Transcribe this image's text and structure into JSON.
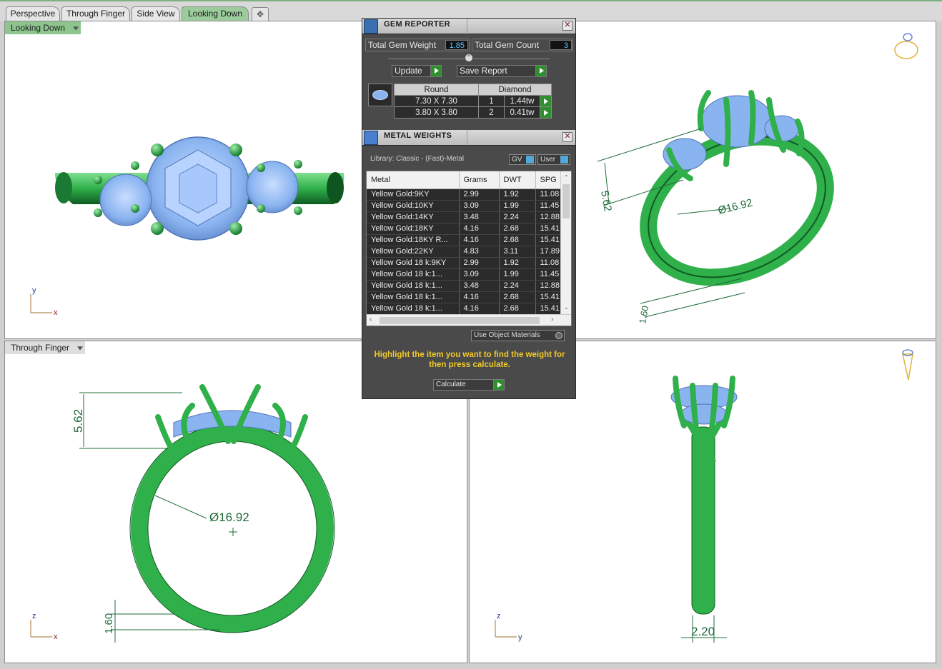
{
  "tabs": [
    {
      "label": "Perspective",
      "active": false
    },
    {
      "label": "Through Finger",
      "active": false
    },
    {
      "label": "Side View",
      "active": false
    },
    {
      "label": "Looking Down",
      "active": true
    }
  ],
  "viewports": {
    "top_left": {
      "title": "Looking Down",
      "axis_a": "y",
      "axis_b": "x"
    },
    "top_right": {
      "dim_height": "5.62",
      "dim_diameter": "Ø16.92",
      "dim_band": "1.60"
    },
    "bottom_left": {
      "title": "Through Finger",
      "axis_a": "z",
      "axis_b": "x",
      "dim_height": "5.62",
      "dim_diameter": "Ø16.92",
      "dim_band": "1.60"
    },
    "bottom_right": {
      "axis_a": "z",
      "axis_b": "y",
      "dim_width": "2.20"
    }
  },
  "gem_reporter": {
    "title": "GEM REPORTER",
    "total_weight_label": "Total Gem Weight",
    "total_weight_value": "1.85",
    "total_count_label": "Total Gem Count",
    "total_count_value": "3",
    "update_label": "Update",
    "save_report_label": "Save Report",
    "table_headers": [
      "Round",
      "Diamond"
    ],
    "rows": [
      {
        "size": "7.30 X 7.30",
        "count": "1",
        "weight": "1.44tw"
      },
      {
        "size": "3.80 X 3.80",
        "count": "2",
        "weight": "0.41tw"
      }
    ]
  },
  "metal_weights": {
    "title": "METAL WEIGHTS",
    "library_label": "Library: Classic - (Fast)-Metal",
    "gv_label": "GV",
    "user_label": "User",
    "headers": [
      "Metal",
      "Grams",
      "DWT",
      "SPG"
    ],
    "rows": [
      {
        "metal": "Yellow Gold:9KY",
        "grams": "2.99",
        "dwt": "1.92",
        "spg": "11.08"
      },
      {
        "metal": "Yellow Gold:10KY",
        "grams": "3.09",
        "dwt": "1.99",
        "spg": "11.45"
      },
      {
        "metal": "Yellow Gold:14KY",
        "grams": "3.48",
        "dwt": "2.24",
        "spg": "12.88"
      },
      {
        "metal": "Yellow Gold:18KY",
        "grams": "4.16",
        "dwt": "2.68",
        "spg": "15.41"
      },
      {
        "metal": "Yellow Gold:18KY R...",
        "grams": "4.16",
        "dwt": "2.68",
        "spg": "15.41"
      },
      {
        "metal": "Yellow Gold:22KY",
        "grams": "4.83",
        "dwt": "3.11",
        "spg": "17.89"
      },
      {
        "metal": "Yellow Gold 18 k:9KY",
        "grams": "2.99",
        "dwt": "1.92",
        "spg": "11.08"
      },
      {
        "metal": "Yellow Gold 18 k:1...",
        "grams": "3.09",
        "dwt": "1.99",
        "spg": "11.45"
      },
      {
        "metal": "Yellow Gold 18 k:1...",
        "grams": "3.48",
        "dwt": "2.24",
        "spg": "12.88"
      },
      {
        "metal": "Yellow Gold 18 k:1...",
        "grams": "4.16",
        "dwt": "2.68",
        "spg": "15.41"
      },
      {
        "metal": "Yellow Gold 18 k:1...",
        "grams": "4.16",
        "dwt": "2.68",
        "spg": "15.41"
      }
    ],
    "use_object_materials_label": "Use Object Materials",
    "hint": "Highlight the item you want to find the weight for then press calculate.",
    "calculate_label": "Calculate"
  },
  "colors": {
    "metal_green": "#2fb04a",
    "gem_blue": "#8ab4f0",
    "dimension_green": "#1f6b3a",
    "active_tab": "#9ccc9c",
    "hint_yellow": "#f2c92a"
  }
}
